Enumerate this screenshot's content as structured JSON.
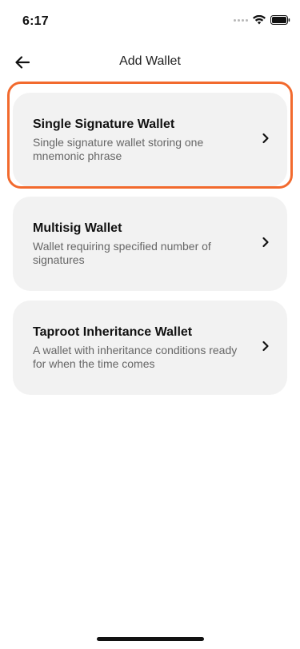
{
  "status_bar": {
    "time": "6:17"
  },
  "header": {
    "title": "Add Wallet",
    "back_icon": "arrow-left-icon"
  },
  "wallet_types": [
    {
      "title": "Single Signature Wallet",
      "description": "Single signature wallet storing one mnemonic phrase",
      "selected": true
    },
    {
      "title": "Multisig Wallet",
      "description": "Wallet requiring specified number of signatures",
      "selected": false
    },
    {
      "title": "Taproot Inheritance Wallet",
      "description": "A wallet with inheritance conditions ready for when the time comes",
      "selected": false
    }
  ],
  "colors": {
    "highlight": "#f26a2e",
    "card_background": "#f2f2f2"
  }
}
